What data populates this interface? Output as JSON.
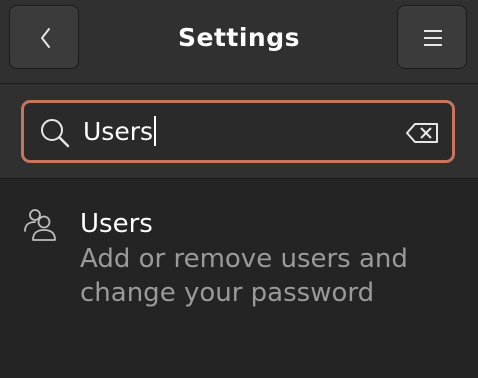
{
  "header": {
    "title": "Settings",
    "back_icon": "chevron-left-icon",
    "menu_icon": "hamburger-menu-icon"
  },
  "search": {
    "value": "Users",
    "search_icon": "search-icon",
    "clear_icon": "backspace-clear-icon",
    "focus_color": "#c7765c"
  },
  "results": [
    {
      "icon": "users-icon",
      "title": "Users",
      "description": "Add or remove users and change your password"
    }
  ],
  "colors": {
    "background": "#242424",
    "header": "#303030",
    "button": "#3b3b3b",
    "secondary_text": "#9a9a9a"
  }
}
